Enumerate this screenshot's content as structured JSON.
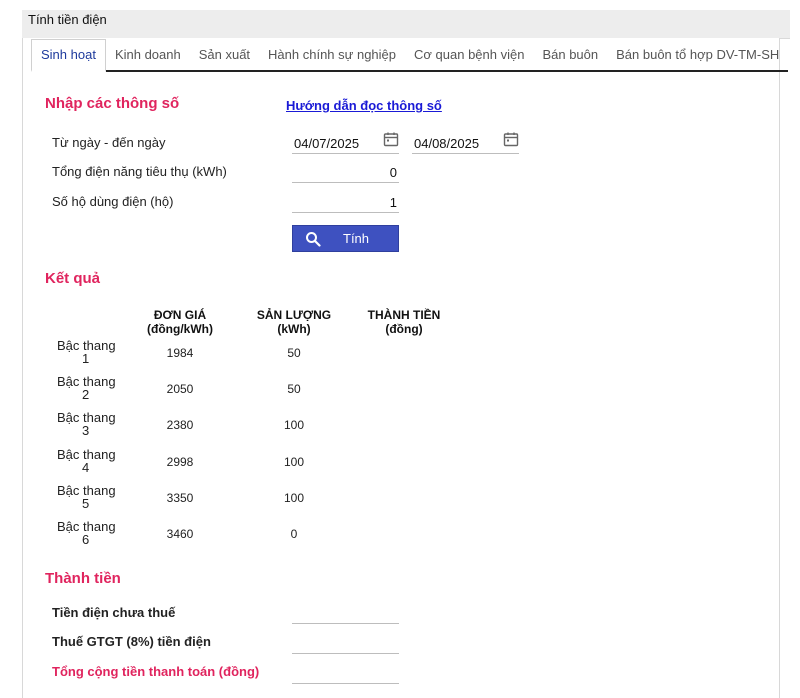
{
  "page_title": "Tính tiền điện",
  "tabs": [
    {
      "label": "Sinh hoạt"
    },
    {
      "label": "Kinh doanh"
    },
    {
      "label": "Sản xuất"
    },
    {
      "label": "Hành chính sự nghiệp"
    },
    {
      "label": "Cơ quan bệnh viện"
    },
    {
      "label": "Bán buôn"
    },
    {
      "label": "Bán buôn tổ hợp DV-TM-SH"
    }
  ],
  "inputs_section": {
    "title": "Nhập các thông số",
    "help_link": "Hướng dẫn đọc thông số",
    "date_range_label": "Từ ngày - đến ngày",
    "from_date": "04/07/2025",
    "to_date": "04/08/2025",
    "consumption_label": "Tổng điện năng tiêu thụ (kWh)",
    "consumption_value": "0",
    "households_label": "Số hộ dùng điện (hộ)",
    "households_value": "1",
    "calc_button": "Tính"
  },
  "results": {
    "title": "Kết quả",
    "headers": {
      "price_line1": "ĐƠN GIÁ",
      "price_line2": "(đồng/kWh)",
      "qty_line1": "SẢN LƯỢNG",
      "qty_line2": "(kWh)",
      "amount_line1": "THÀNH TIỀN",
      "amount_line2": "(đồng)"
    },
    "rows": [
      {
        "tier_label": "Bậc thang",
        "tier_num": "1",
        "price": "1984",
        "qty": "50"
      },
      {
        "tier_label": "Bậc thang",
        "tier_num": "2",
        "price": "2050",
        "qty": "50"
      },
      {
        "tier_label": "Bậc thang",
        "tier_num": "3",
        "price": "2380",
        "qty": "100"
      },
      {
        "tier_label": "Bậc thang",
        "tier_num": "4",
        "price": "2998",
        "qty": "100"
      },
      {
        "tier_label": "Bậc thang",
        "tier_num": "5",
        "price": "3350",
        "qty": "100"
      },
      {
        "tier_label": "Bậc thang",
        "tier_num": "6",
        "price": "3460",
        "qty": "0"
      }
    ]
  },
  "totals": {
    "title": "Thành tiền",
    "pre_tax_label": "Tiền điện chưa thuế",
    "vat_label": "Thuế GTGT (8%) tiền điện",
    "total_label": "Tổng cộng tiền thanh toán (đồng)"
  },
  "colors": {
    "section_title": "#e0245e",
    "active_tab": "#1e3a9c",
    "button_bg": "#3e51c0",
    "link": "#1a1ad6"
  }
}
